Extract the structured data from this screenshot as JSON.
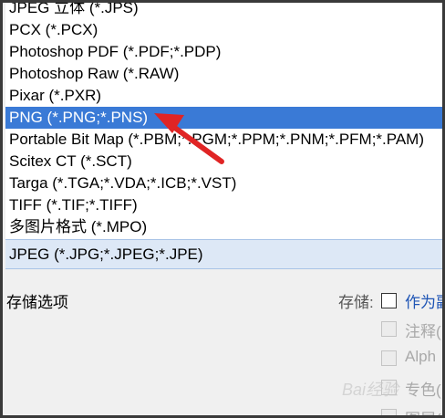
{
  "format_list": {
    "items": [
      "JPEG 立体 (*.JPS)",
      "PCX (*.PCX)",
      "Photoshop PDF (*.PDF;*.PDP)",
      "Photoshop Raw (*.RAW)",
      "Pixar (*.PXR)",
      "PNG (*.PNG;*.PNS)",
      "Portable Bit Map (*.PBM;*.PGM;*.PPM;*.PNM;*.PFM;*.PAM)",
      "Scitex CT (*.SCT)",
      "Targa (*.TGA;*.VDA;*.ICB;*.VST)",
      "TIFF (*.TIF;*.TIFF)",
      "多图片格式 (*.MPO)"
    ],
    "selected_index": 5
  },
  "format_combo": {
    "value": "JPEG (*.JPG;*.JPEG;*.JPE)"
  },
  "save_options": {
    "section_label": "存储选项",
    "save_label": "存储:",
    "as_copy_label": "作为副",
    "annotations_label": "注释(",
    "alpha_label": "Alph",
    "spot_label": "专色(",
    "layers_label": "图层("
  },
  "watermark": "Bai经验",
  "colors": {
    "selection": "#3a7ad6",
    "arrow": "#e02424",
    "link": "#1f55b5"
  }
}
